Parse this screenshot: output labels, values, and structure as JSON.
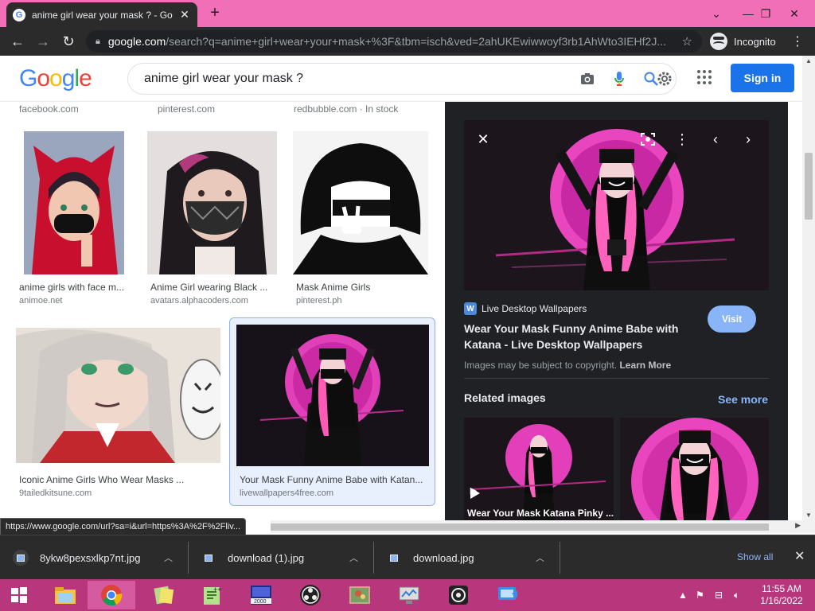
{
  "browser": {
    "tab_title": "anime girl wear your mask ? - Go",
    "tab_favicon": "G",
    "url_domain": "google.com",
    "url_rest": "/search?q=anime+girl+wear+your+mask+%3F&tbm=isch&ved=2ahUKEwiwwoyf3rb1AhWto3IEHf2J...",
    "profile_label": "Incognito",
    "status_url": "https://www.google.com/url?sa=i&url=https%3A%2F%2Fliv..."
  },
  "google": {
    "logo": [
      "G",
      "o",
      "o",
      "g",
      "l",
      "e"
    ],
    "query": "anime girl wear your mask ?",
    "signin_label": "Sign in"
  },
  "results": {
    "top_sources": [
      "facebook.com",
      "pinterest.com",
      "redbubble.com · In stock"
    ],
    "items": [
      {
        "caption": "anime girls with face m...",
        "source": "animoe.net"
      },
      {
        "caption": "Anime Girl wearing Black ...",
        "source": "avatars.alphacoders.com"
      },
      {
        "caption": "Mask Anime Girls",
        "source": "pinterest.ph"
      },
      {
        "caption": "Iconic Anime Girls Who Wear Masks ...",
        "source": "9tailedkitsune.com"
      },
      {
        "caption": "Your Mask Funny Anime Babe with Katan...",
        "source": "livewallpapers4free.com"
      }
    ]
  },
  "preview": {
    "site_name": "Live Desktop Wallpapers",
    "site_icon": "W",
    "title": "Wear Your Mask Funny Anime Babe with Katana - Live Desktop Wallpapers",
    "visit_label": "Visit",
    "copyright_text": "Images may be subject to copyright.",
    "learn_more": "Learn More",
    "related_label": "Related images",
    "see_more": "See more",
    "related_caption": "Wear Your Mask Katana Pinky ..."
  },
  "downloads": {
    "files": [
      "8ykw8pexsxlkp7nt.jpg",
      "download (1).jpg",
      "download.jpg"
    ],
    "show_all": "Show all"
  },
  "taskbar": {
    "time": "11:55 AM",
    "date": "1/16/2022"
  },
  "colors": {
    "accent_pink": "#f06fb7",
    "taskbar_pink": "#b7367c",
    "google_blue": "#1a73e8",
    "panel_dark": "#202124"
  }
}
